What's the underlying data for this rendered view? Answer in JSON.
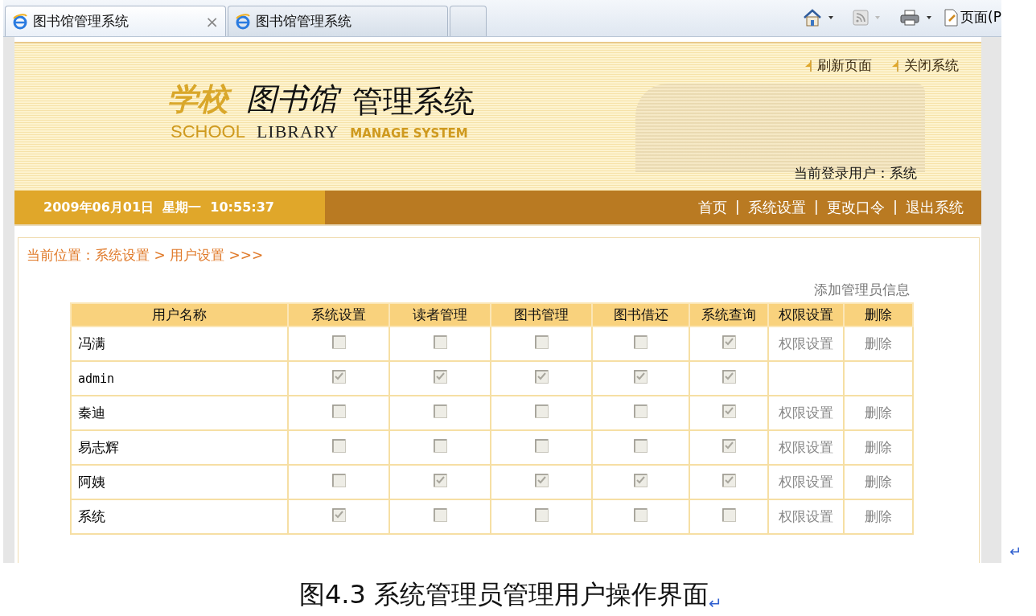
{
  "browser": {
    "tabs": [
      {
        "title": "图书馆管理系统",
        "selected": true,
        "close": "×"
      },
      {
        "title": "图书馆管理系统",
        "selected": false
      },
      {
        "selected": false
      }
    ],
    "toolbar": {
      "page_menu": "页面(P"
    }
  },
  "header": {
    "logo": {
      "school_cn": "学校",
      "library_cn": "图书馆",
      "manage_cn": "管理系统",
      "school_en": "SCHOOL",
      "library_en": "LIBRARY",
      "manage_en": "MANAGE SYSTEM"
    },
    "links": [
      "刷新页面",
      "关闭系统"
    ],
    "current_user": "当前登录用户：系统"
  },
  "nav": {
    "datetime": "2009年06月01日  星期一  10:55:37",
    "links": [
      "首页",
      "系统设置",
      "更改口令",
      "退出系统"
    ],
    "separator": "|"
  },
  "breadcrumb": "当前位置：系统设置 > 用户设置 >>>",
  "add_link": "添加管理员信息",
  "table": {
    "columns": [
      "用户名称",
      "系统设置",
      "读者管理",
      "图书管理",
      "图书借还",
      "系统查询",
      "权限设置",
      "删除"
    ],
    "rows": [
      {
        "name": "冯满",
        "permissions": [
          false,
          false,
          false,
          false,
          true
        ],
        "edit_link": "权限设置",
        "delete_link": "删除"
      },
      {
        "name": "admin",
        "permissions": [
          true,
          true,
          true,
          true,
          true
        ]
      },
      {
        "name": "秦迪",
        "permissions": [
          false,
          false,
          false,
          false,
          true
        ],
        "edit_link": "权限设置",
        "delete_link": "删除"
      },
      {
        "name": "易志辉",
        "permissions": [
          false,
          false,
          false,
          false,
          true
        ],
        "edit_link": "权限设置",
        "delete_link": "删除"
      },
      {
        "name": "阿姨",
        "permissions": [
          false,
          true,
          true,
          true,
          true
        ],
        "edit_link": "权限设置",
        "delete_link": "删除"
      },
      {
        "name": "系统",
        "permissions": [
          true,
          false,
          false,
          false,
          false
        ],
        "edit_link": "权限设置",
        "delete_link": "删除"
      }
    ]
  },
  "document": {
    "side_mark": "↵",
    "caption": "图4.3 系统管理员管理用户操作界面",
    "caption_mark": "↵"
  }
}
